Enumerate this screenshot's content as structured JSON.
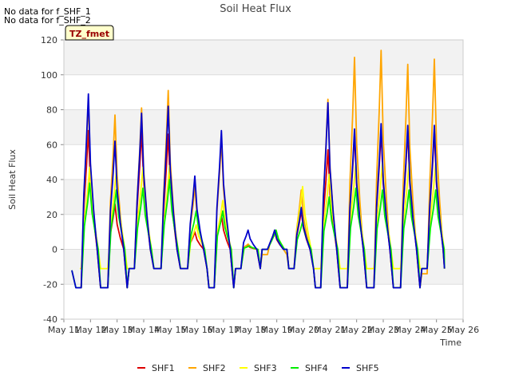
{
  "notes": [
    "No data for f_SHF_1",
    "No data for f_SHF_2"
  ],
  "tz_label": "TZ_fmet",
  "chart_data": {
    "type": "line",
    "title": "Soil Heat Flux",
    "xlabel": "Time",
    "ylabel": "Soil Heat Flux",
    "ylim": [
      -40,
      120
    ],
    "yticks": [
      -40,
      -20,
      0,
      20,
      40,
      60,
      80,
      100,
      120
    ],
    "xlim": [
      11,
      26
    ],
    "xticks": [
      11,
      12,
      13,
      14,
      15,
      16,
      17,
      18,
      19,
      20,
      21,
      22,
      23,
      24,
      25,
      26
    ],
    "xtick_labels": [
      "May 11",
      "May 12",
      "May 13",
      "May 14",
      "May 15",
      "May 16",
      "May 17",
      "May 18",
      "May 19",
      "May 20",
      "May 21",
      "May 22",
      "May 23",
      "May 24",
      "May 25",
      "May 26"
    ],
    "grid": "horizontal bands",
    "legend_position": "bottom",
    "series": [
      {
        "name": "SHF1",
        "color": "#dd0000",
        "peaks": [
          68,
          26,
          68,
          66,
          10,
          20,
          2,
          10,
          22,
          57,
          66,
          68,
          68,
          68
        ],
        "troughs": [
          -22,
          -22,
          -11,
          -11,
          -11,
          -22,
          -11,
          0,
          -11,
          -22,
          -22,
          -22,
          -22,
          -11
        ],
        "start": 11.6,
        "end": 25.3
      },
      {
        "name": "SHF2",
        "color": "#ffa500",
        "peaks": [
          85,
          77,
          81,
          91,
          36,
          62,
          3,
          11,
          34,
          86,
          110,
          114,
          106,
          109
        ],
        "troughs": [
          -22,
          -22,
          -11,
          -11,
          -11,
          -22,
          -11,
          -3,
          -11,
          -22,
          -22,
          -22,
          -22,
          -14
        ],
        "start": 11.6,
        "end": 25.3
      },
      {
        "name": "SHF3",
        "color": "#ffff00",
        "peaks": [
          47,
          45,
          47,
          48,
          14,
          28,
          2,
          11,
          36,
          43,
          50,
          50,
          50,
          50
        ],
        "troughs": [
          -11,
          -11,
          -11,
          -11,
          -11,
          -22,
          -11,
          0,
          -11,
          -11,
          -11,
          -11,
          -11,
          -11
        ],
        "start": 11.6,
        "end": 25.3
      },
      {
        "name": "SHF4",
        "color": "#00ee00",
        "peaks": [
          38,
          34,
          35,
          40,
          22,
          22,
          2,
          11,
          16,
          30,
          35,
          34,
          34,
          34
        ],
        "troughs": [
          -22,
          -22,
          -11,
          -11,
          -11,
          -22,
          -11,
          0,
          -11,
          -22,
          -22,
          -22,
          -22,
          -11
        ],
        "start": 11.3,
        "end": 25.3
      },
      {
        "name": "SHF5",
        "color": "#0000cc",
        "peaks": [
          89,
          62,
          78,
          82,
          42,
          68,
          11,
          11,
          24,
          84,
          69,
          72,
          71,
          71
        ],
        "troughs": [
          -22,
          -22,
          -11,
          -11,
          -11,
          -22,
          -11,
          0,
          -11,
          -22,
          -22,
          -22,
          -22,
          -11
        ],
        "start": 11.3,
        "end": 25.3
      }
    ]
  }
}
